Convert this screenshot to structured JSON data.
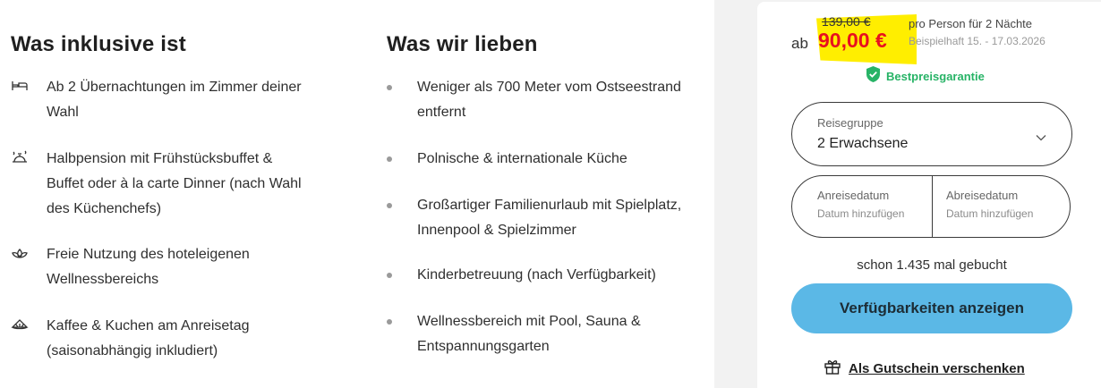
{
  "included": {
    "heading": "Was inklusive ist",
    "items": [
      {
        "icon": "bed-icon",
        "text": "Ab 2 Übernachtungen im Zimmer deiner Wahl"
      },
      {
        "icon": "dining-icon",
        "text": "Halbpension mit Frühstücksbuffet & Buffet oder à la carte Dinner (nach Wahl des Küchenchefs)"
      },
      {
        "icon": "lotus-icon",
        "text": "Freie Nutzung des hoteleigenen Wellnessbereichs"
      },
      {
        "icon": "cake-icon",
        "text": "Kaffee & Kuchen am Anreisetag (saisonabhängig inkludiert)"
      }
    ]
  },
  "loves": {
    "heading": "Was wir lieben",
    "items": [
      "Weniger als 700 Meter vom Ostseestrand entfernt",
      "Polnische & internationale Küche",
      "Großartiger Familienurlaub mit Spielplatz, Innenpool & Spielzimmer",
      "Kinderbetreuung (nach Verfügbarkeit)",
      "Wellnessbereich mit Pool, Sauna & Entspannungsgarten"
    ]
  },
  "booking": {
    "old_price": "139,00 €",
    "prefix": "ab",
    "price": "90,00 €",
    "per_person": "pro Person für 2 Nächte",
    "example": "Beispielhaft 15. - 17.03.2026",
    "guarantee": "Bestpreisgarantie",
    "group_label": "Reisegruppe",
    "group_value": "2 Erwachsene",
    "arrival_label": "Anreisedatum",
    "arrival_placeholder": "Datum hinzufügen",
    "departure_label": "Abreisedatum",
    "departure_placeholder": "Datum hinzufügen",
    "booked_count": "schon 1.435 mal gebucht",
    "cta": "Verfügbarkeiten anzeigen",
    "voucher": "Als Gutschein verschenken"
  },
  "colors": {
    "accent": "#5bb8e6",
    "price_red": "#e8101f",
    "highlight": "#ffee00",
    "guarantee_green": "#27b366"
  }
}
